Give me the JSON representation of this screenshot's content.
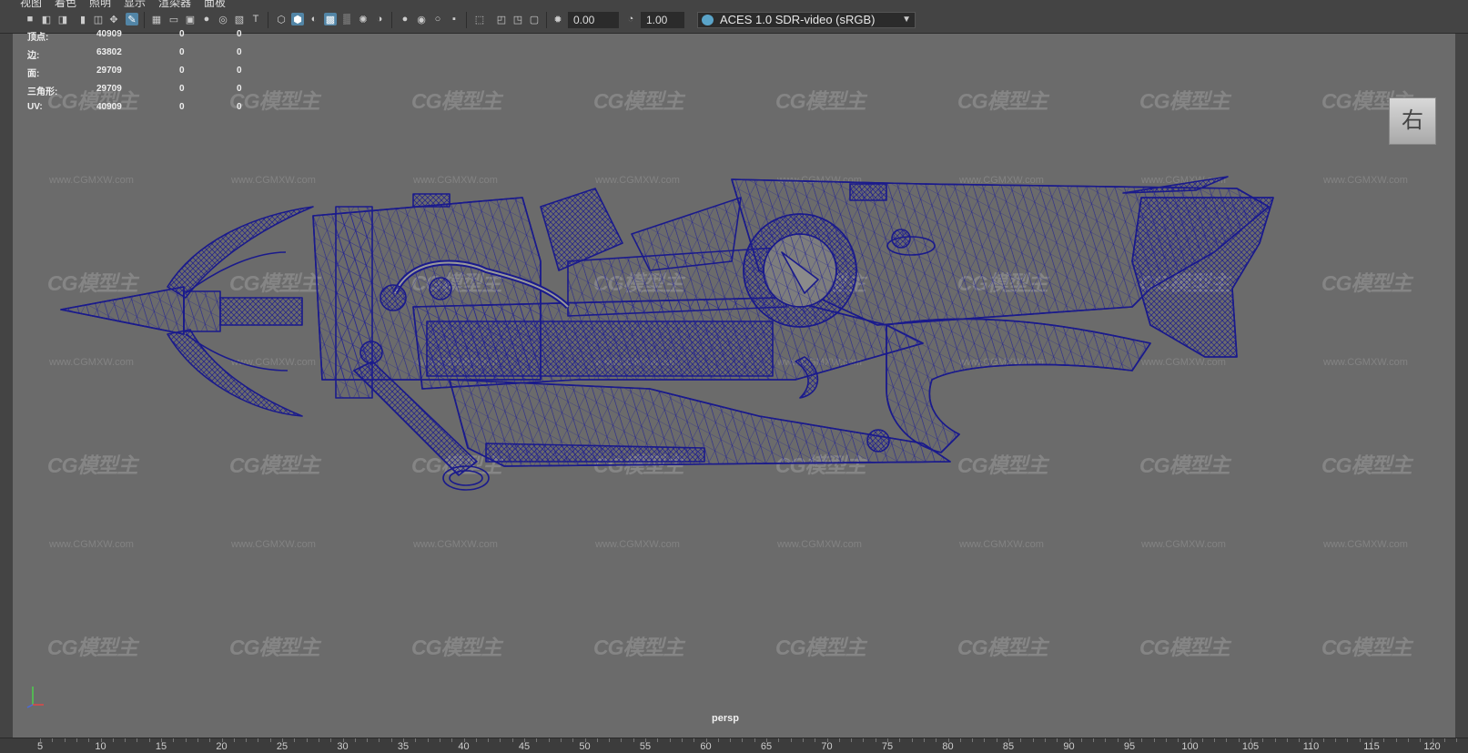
{
  "menu": [
    "视图",
    "着色",
    "照明",
    "显示",
    "渲染器",
    "面板"
  ],
  "toolbar": {
    "field_a": "0.00",
    "field_b": "1.00",
    "color_space": "ACES 1.0 SDR-video (sRGB)"
  },
  "hud": [
    {
      "label": "顶点:",
      "v1": "40909",
      "v2": "0",
      "v3": "0"
    },
    {
      "label": "边:",
      "v1": "63802",
      "v2": "0",
      "v3": "0"
    },
    {
      "label": "面:",
      "v1": "29709",
      "v2": "0",
      "v3": "0"
    },
    {
      "label": "三角形:",
      "v1": "29709",
      "v2": "0",
      "v3": "0"
    },
    {
      "label": "UV:",
      "v1": "40909",
      "v2": "0",
      "v3": "0"
    }
  ],
  "view_cube_label": "右",
  "camera_label": "persp",
  "watermark": {
    "logo": "CG模型主",
    "url": "www.CGMXW.com"
  },
  "timeline": [
    "5",
    "10",
    "15",
    "20",
    "25",
    "30",
    "35",
    "40",
    "45",
    "50",
    "55",
    "60",
    "65",
    "70",
    "75",
    "80",
    "85",
    "90",
    "95",
    "100",
    "105",
    "110",
    "115",
    "120"
  ],
  "colors": {
    "viewport_bg": "#6b6b6b",
    "wire": "#1a1a8c",
    "highlight": "#5285a6"
  }
}
